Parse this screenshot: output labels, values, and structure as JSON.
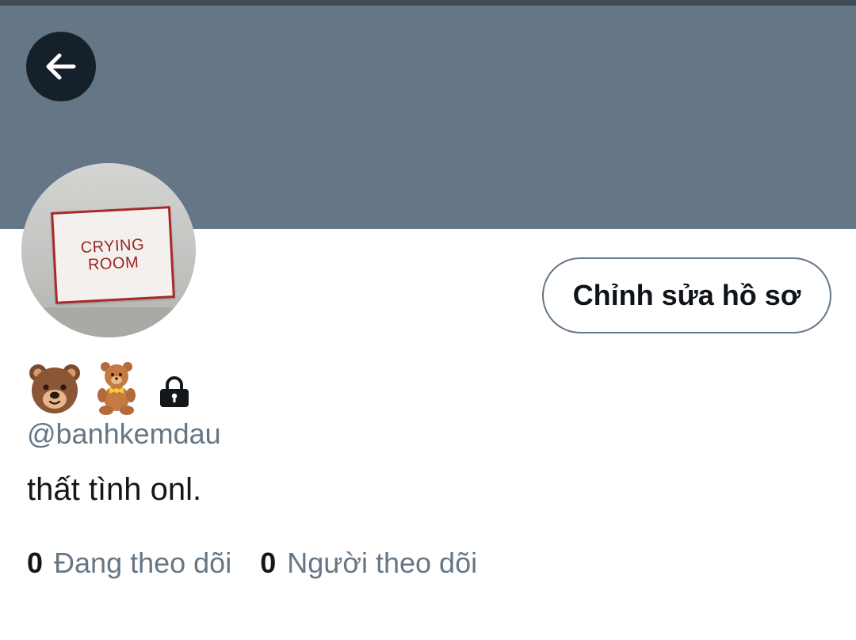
{
  "header": {
    "back_icon": "arrow-left-icon",
    "banner_color": "#657786"
  },
  "profile": {
    "avatar_sign_lines": [
      "CRYING",
      "ROOM"
    ],
    "display_name_icons": [
      "bear-face-icon",
      "teddy-bear-icon",
      "lock-icon"
    ],
    "handle": "@banhkemdau",
    "bio": "thất tình onl.",
    "edit_button_label": "Chỉnh sửa hồ sơ"
  },
  "stats": {
    "following_count": "0",
    "following_label": "Đang theo dõi",
    "followers_count": "0",
    "followers_label": "Người theo dõi"
  },
  "colors": {
    "secondary_text": "#657786",
    "primary_text": "#14171a",
    "back_button_bg": "#15202b"
  }
}
